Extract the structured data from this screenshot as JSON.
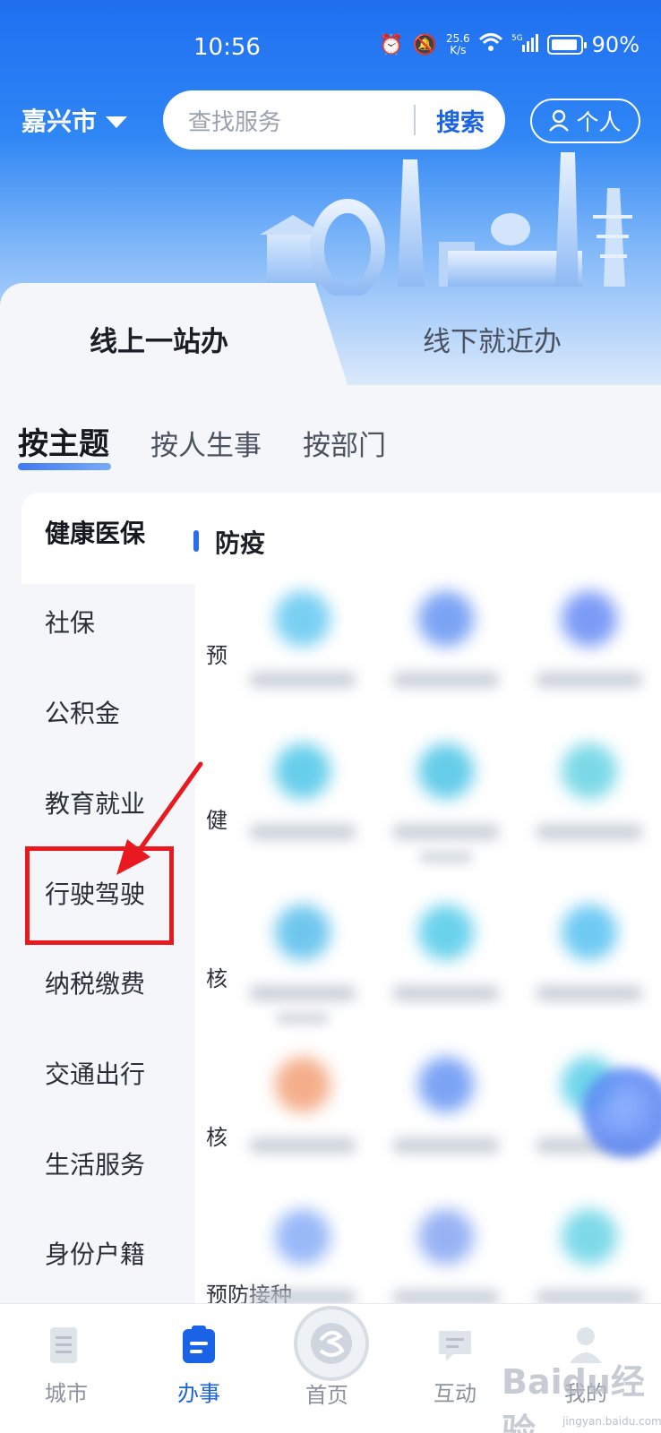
{
  "status_bar": {
    "time": "10:56",
    "speed": "25.6\nK/s",
    "network": "5G",
    "battery": "90%"
  },
  "header": {
    "city": "嘉兴市",
    "search_placeholder": "查找服务",
    "search_button": "搜索",
    "personal": "个人"
  },
  "mode_tabs": {
    "online": "线上一站办",
    "offline": "线下就近办"
  },
  "category_tabs": [
    "按主题",
    "按人生事",
    "按部门"
  ],
  "sidebar": [
    "健康医保",
    "社保",
    "公积金",
    "教育就业",
    "行驶驾驶",
    "纳税缴费",
    "交通出行",
    "生活服务",
    "身份户籍"
  ],
  "section": {
    "title": "防疫"
  },
  "row_labels": [
    "预",
    "健",
    "核",
    "核",
    "预防接种"
  ],
  "bottom_nav": {
    "city": "城市",
    "services": "办事",
    "home": "首页",
    "interact": "互动",
    "mine": "我的"
  },
  "watermark": {
    "brand": "Baidu经验",
    "url": "jingyan.baidu.com"
  },
  "colors": {
    "primary": "#1a63e6",
    "annotation": "#e8191f"
  }
}
